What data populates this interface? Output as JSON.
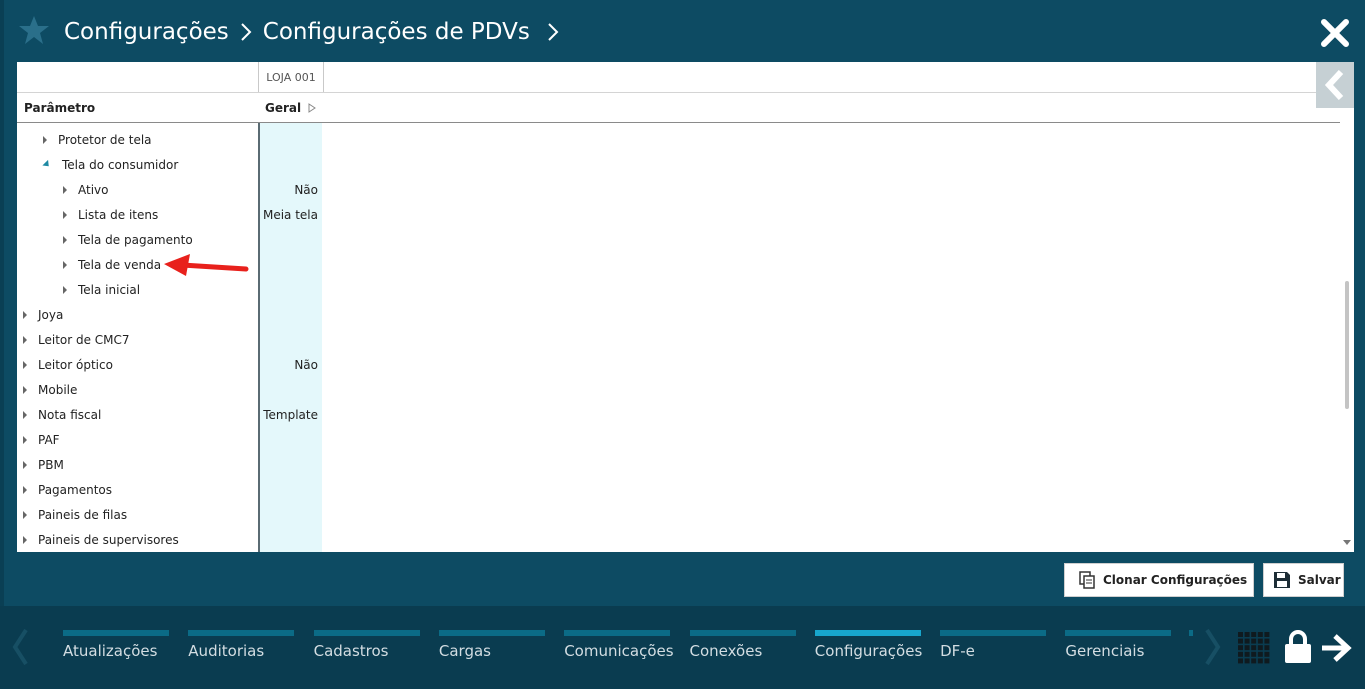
{
  "header": {
    "breadcrumb": [
      "Configurações",
      "Configurações de PDVs"
    ]
  },
  "grid": {
    "store_label": "LOJA 001",
    "param_header": "Parâmetro",
    "value_header": "Geral"
  },
  "tree": [
    {
      "label": "Protetor de tela",
      "level": 1,
      "expanded": false,
      "value": ""
    },
    {
      "label": "Tela do consumidor",
      "level": 1,
      "expanded": true,
      "value": ""
    },
    {
      "label": "Ativo",
      "level": 2,
      "expanded": false,
      "value": "Não"
    },
    {
      "label": "Lista de itens",
      "level": 2,
      "expanded": false,
      "value": "Meia tela"
    },
    {
      "label": "Tela de pagamento",
      "level": 2,
      "expanded": false,
      "value": ""
    },
    {
      "label": "Tela de venda",
      "level": 2,
      "expanded": false,
      "value": ""
    },
    {
      "label": "Tela inicial",
      "level": 2,
      "expanded": false,
      "value": ""
    },
    {
      "label": "Joya",
      "level": 0,
      "expanded": false,
      "value": ""
    },
    {
      "label": "Leitor de CMC7",
      "level": 0,
      "expanded": false,
      "value": ""
    },
    {
      "label": "Leitor óptico",
      "level": 0,
      "expanded": false,
      "value": "Não"
    },
    {
      "label": "Mobile",
      "level": 0,
      "expanded": false,
      "value": ""
    },
    {
      "label": "Nota fiscal",
      "level": 0,
      "expanded": false,
      "value": "Template"
    },
    {
      "label": "PAF",
      "level": 0,
      "expanded": false,
      "value": ""
    },
    {
      "label": "PBM",
      "level": 0,
      "expanded": false,
      "value": ""
    },
    {
      "label": "Pagamentos",
      "level": 0,
      "expanded": false,
      "value": ""
    },
    {
      "label": "Paineis de filas",
      "level": 0,
      "expanded": false,
      "value": ""
    },
    {
      "label": "Paineis de supervisores",
      "level": 0,
      "expanded": false,
      "value": ""
    }
  ],
  "actions": {
    "clone_label": "Clonar Configurações",
    "save_label": "Salvar"
  },
  "nav": {
    "items": [
      {
        "label": "Atualizações",
        "active": false
      },
      {
        "label": "Auditorias",
        "active": false
      },
      {
        "label": "Cadastros",
        "active": false
      },
      {
        "label": "Cargas",
        "active": false
      },
      {
        "label": "Comunicações",
        "active": false
      },
      {
        "label": "Conexões",
        "active": false
      },
      {
        "label": "Configurações",
        "active": true
      },
      {
        "label": "DF-e",
        "active": false
      },
      {
        "label": "Gerenciais",
        "active": false
      }
    ]
  },
  "colors": {
    "header_bg": "#0d4b63",
    "bottom_bar_bg": "#0a3c50",
    "active_tab": "#17a6cd",
    "inactive_tab": "#0b6b86",
    "value_column_bg": "#e4f8fb",
    "annotation_arrow": "#e8211c"
  },
  "icons": {
    "header": "star-icon",
    "close": "close-icon",
    "collapse": "chevron-left-icon",
    "clone": "copy-icon",
    "save": "floppy-disk-icon",
    "apps": "grid-icon",
    "lock": "lock-icon",
    "logout": "arrow-right-icon"
  }
}
